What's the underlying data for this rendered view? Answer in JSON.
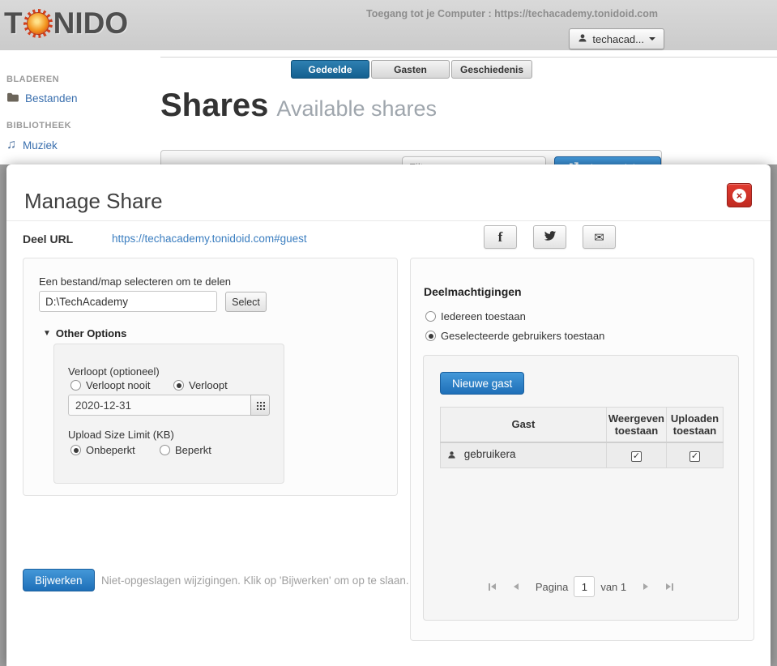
{
  "colors": {
    "accent_blue": "#1e6fb8",
    "active_tab_blue": "#14608f",
    "link_blue": "#3b7ec0",
    "close_red": "#c02a21"
  },
  "icons": {
    "close": "×",
    "facebook": "f",
    "mail": "✉",
    "collapse_arrow": "▼",
    "check": "✓",
    "music": "♫"
  },
  "header": {
    "logo_t": "T",
    "logo_rest": "NIDO",
    "access_text": "Toegang tot je Computer : https://techacademy.tonidoid.com",
    "user_menu": {
      "label": "techacad..."
    }
  },
  "sidebar": {
    "browse_title": "BLADEREN",
    "files_item": "Bestanden",
    "library_title": "BIBLIOTHEEK",
    "music_item": "Muziek"
  },
  "main": {
    "tabs": [
      {
        "label": "Gedeelde",
        "active": true
      },
      {
        "label": "Gasten",
        "active": false
      },
      {
        "label": "Geschiedenis",
        "active": false
      }
    ],
    "title": "Shares",
    "subtitle": "Available shares",
    "filter_placeholder": "Filter...",
    "new_share_button": "Nieuwe delen"
  },
  "modal": {
    "title": "Manage Share",
    "share_url_label": "Deel URL",
    "share_url": "https://techacademy.tonidoid.com#guest",
    "file_section": {
      "label": "Een bestand/map selecteren om te delen",
      "path_value": "D:\\TechAcademy",
      "select_button": "Select",
      "other_options": "Other Options",
      "expires_label": "Verloopt (optioneel)",
      "expires_never": "Verloopt nooit",
      "expires_on": "Verloopt",
      "expires_selected": "Verloopt",
      "expire_date": "2020-12-31",
      "upload_limit_label": "Upload Size Limit (KB)",
      "unlimited": "Onbeperkt",
      "limited": "Beperkt",
      "limit_selected": "Onbeperkt"
    },
    "update_button": "Bijwerken",
    "unsaved_text": "Niet-opgeslagen wijzigingen. Klik op 'Bijwerken' om op te slaan.",
    "permissions": {
      "title": "Deelmachtigingen",
      "allow_everyone": "Iedereen toestaan",
      "allow_selected": "Geselecteerde gebruikers toestaan",
      "selected_option": "Geselecteerde gebruikers toestaan",
      "new_guest_button": "Nieuwe gast",
      "table": {
        "headers": [
          "Gast",
          "Weergeven toestaan",
          "Uploaden toestaan"
        ],
        "rows": [
          {
            "name": "gebruikera",
            "view_allowed": true,
            "upload_allowed": true
          }
        ]
      },
      "pagination": {
        "page_label": "Pagina",
        "current_page": "1",
        "of_label": "van 1"
      }
    }
  }
}
